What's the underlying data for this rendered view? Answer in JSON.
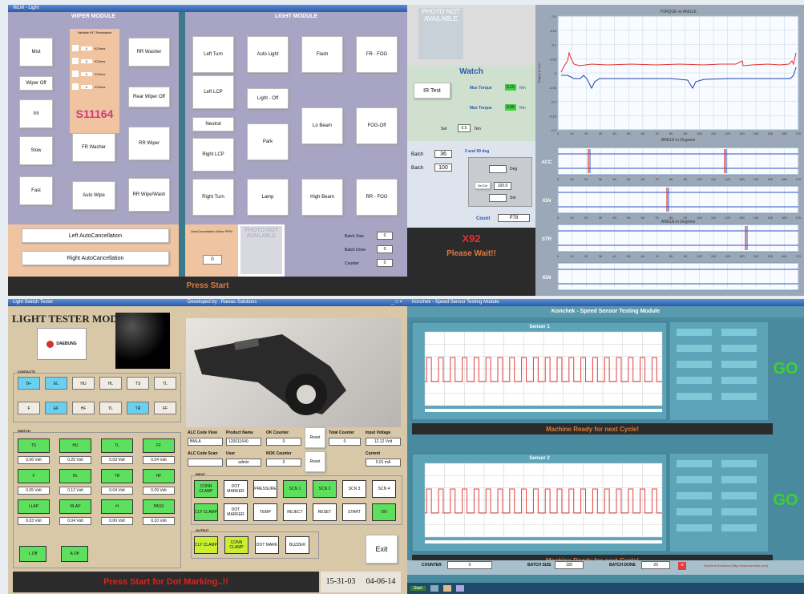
{
  "wiper": {
    "title": "WIPER MODULE",
    "buttons_left": [
      "Mist",
      "Wiper Off",
      "Int",
      "Slow",
      "Fast"
    ],
    "resistance_title": "Variable INT Resistance",
    "resistance_rows": [
      {
        "value": "0",
        "unit": "KOhms"
      },
      {
        "value": "0",
        "unit": "KOhms"
      },
      {
        "value": "0",
        "unit": "KOhms"
      },
      {
        "value": "0",
        "unit": "KOhms"
      }
    ],
    "model": "S11164",
    "buttons_mid": [
      "FR Washer",
      "Auto Wipe"
    ],
    "buttons_right": [
      "RR Washer",
      "Rear Wiper Off",
      "RR Wiper",
      "RR Wipe/Wash"
    ],
    "left_auto": "Left AutoCancellation",
    "right_auto": "Right AutoCancellation",
    "motor_title": "AutoCancellation Motor RPM",
    "motor_value": "0"
  },
  "light": {
    "title": "LIGHT MODULE",
    "col1": [
      "Left Turn",
      "Left LCP",
      "Neutral",
      "Right LCP",
      "Right Turn"
    ],
    "col2": [
      "Auto Light",
      "Light - Off",
      "Park",
      "Lamp"
    ],
    "col3": [
      "Flash",
      "Lo Beam",
      "High Beam"
    ],
    "col4": [
      "FR - FOG",
      "FOG-Off",
      "RR - FOG"
    ],
    "batch_size_label": "Batch Size",
    "batch_size": "0",
    "batch_done_label": "Batch Done",
    "batch_done": "0",
    "counter_label": "Counter",
    "counter": "0"
  },
  "press_start": "Press Start",
  "photo_text": "PHOTO NOT AVAILABLE",
  "torque": {
    "watch": "Watch",
    "ir_test": "IR Test",
    "max_torque_label": "Max Torque",
    "max_torque_1": "0.15",
    "max_torque_2": "0.06",
    "unit": "Nm",
    "set_label": "Set",
    "set_value": "0.5",
    "batch_label": "Batch",
    "batch_value": "36",
    "batch2_label": "Batch",
    "batch2_value": "100",
    "deg_title": "0 and 90 deg",
    "deg_label": "Deg",
    "set_de_label": "Set De",
    "set_de_value": "100.0",
    "set2": "Set",
    "count_label": "Count",
    "count_value": "P78",
    "model": "X92",
    "status": "Please Wait!!",
    "chart_title": "TORQUE vs ANGLE",
    "xlabel": "ANGLE in Degrees",
    "ylabel": "Torque in N-m",
    "yticks": [
      "0.2",
      "0.15",
      "0.1",
      "0.05",
      "0",
      "-0.05",
      "-0.1",
      "-0.15",
      "-0.2"
    ],
    "xticks": [
      "0",
      "10",
      "20",
      "30",
      "40",
      "50",
      "60",
      "70",
      "80",
      "90",
      "100",
      "110",
      "120",
      "130",
      "140",
      "150",
      "160",
      "170"
    ],
    "sub_labels": [
      "ACC",
      "IGN",
      "STR",
      "IGN"
    ],
    "sub_xlabel": "ANGLE in Degrees"
  },
  "tester": {
    "window_title": "Light Switch Tester",
    "developer": "Developed by : Rawas Solutions",
    "title": "LIGHT TESTER MODULE",
    "logo": "DAEBUNG",
    "contacts_label": "CONTACTS",
    "contacts_row1": [
      "B+",
      "EL",
      "HU",
      "HL",
      "TS",
      "TL"
    ],
    "contacts_row2": [
      "F",
      "EF",
      "HF",
      "TL",
      "TR",
      "FF"
    ],
    "switch_label": "SWITCH",
    "switch_rows": [
      {
        "buttons": [
          "TS",
          "HU",
          "TL",
          "FF"
        ],
        "values": [
          "0.06 Volt",
          "0.25 Volt",
          "0.03 Volt",
          "0.04 Volt"
        ]
      },
      {
        "buttons": [
          "F",
          "HL",
          "TR",
          "HF"
        ],
        "values": [
          "0.05 Volt",
          "0.12 Volt",
          "0.04 Volt",
          "0.09 Volt"
        ]
      },
      {
        "buttons": [
          "LLAP",
          "RLAP",
          "H",
          "PASS"
        ],
        "values": [
          "0.03 Volt",
          "0.04 Volt",
          "0.00 Volt",
          "0.10 Volt"
        ]
      }
    ],
    "last_row": [
      "L Off",
      "A Off"
    ],
    "alc_code_view": "ALC Code View",
    "alc_code_value": "BMLA",
    "product_name": "Product Name",
    "product_value": "120011640",
    "ok_counter": "OK Counter",
    "ok_value": "0",
    "reset": "Reset",
    "total_counter": "Total Counter",
    "total_value": "0",
    "input_voltage": "Input Voltage",
    "input_voltage_value": "12.12 Volt",
    "alc_code_scan": "ALC Code Scan",
    "user": "User",
    "user_value": "admin",
    "nok_counter": "NOK Counter",
    "nok_value": "0",
    "current": "Current",
    "current_value": "0.01 mA",
    "input_label": "INPUT",
    "input_row1": [
      "CONN CLAMP",
      "DOT MARKER",
      "PRESSURE",
      "SCN 1",
      "SCN 2",
      "SCN 3",
      "SCN 4"
    ],
    "input_row2": [
      "CLY CLAMP",
      "DOT MARKER",
      "TEMP",
      "REJECT",
      "RESET",
      "START",
      "ON"
    ],
    "output_label": "OUTPUT",
    "output_row": [
      "CLY CLAMP",
      "CONN CLAMP",
      "DOT MARK",
      "BUZZER"
    ],
    "exit": "Exit",
    "status": "Press Start for Dot Marking..!!",
    "time": "15-31-03",
    "date": "04-06-14"
  },
  "speed": {
    "window_title": "Konchek - Speed Sensor Testing Module",
    "title": "Konchek - Speed Sensor Testing Module",
    "sensor1": "Sensor 1",
    "sensor2": "Sensor 2",
    "ready": "Machine Ready for next Cycle!",
    "go": "GO",
    "counter_label": "COUNTER",
    "counter_value": "0",
    "batch_size_label": "BATCH SIZE",
    "batch_size": "100",
    "batch_done_label": "BATCH DONE",
    "batch_done": "20",
    "footer_note": "Konchek Solutions (http://www.konchek.com)"
  },
  "taskbar": {
    "start": "Start"
  }
}
